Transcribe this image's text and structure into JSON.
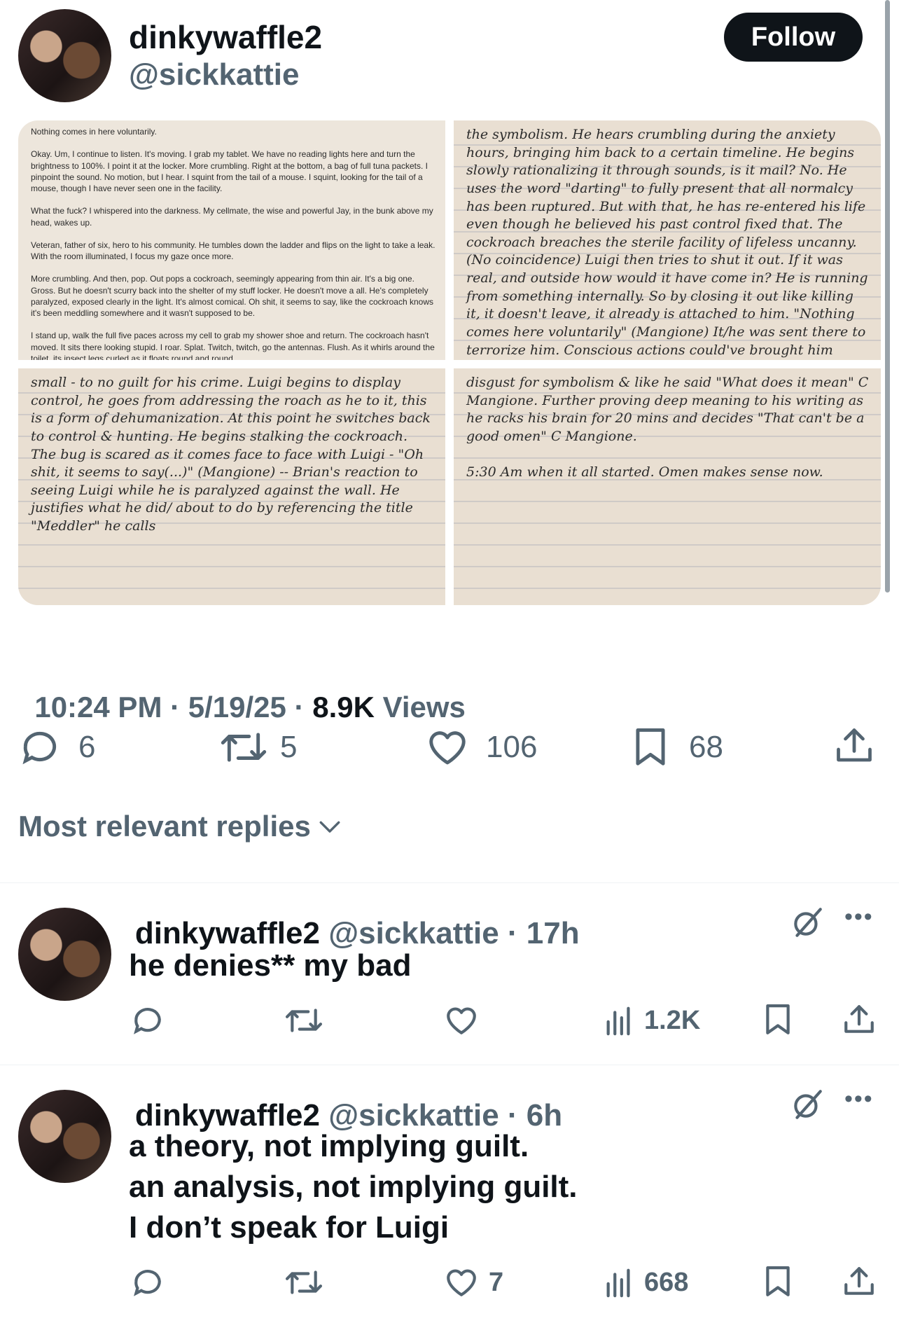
{
  "post": {
    "display_name": "dinkywaffle2",
    "handle": "@sickkattie",
    "follow_label": "Follow",
    "timestamp": "10:24 PM · 5/19/25 · ",
    "views_count": "8.9K",
    "views_label": " Views",
    "stats": {
      "replies": "6",
      "reposts": "5",
      "likes": "106",
      "bookmarks": "68"
    },
    "photos": [
      {
        "kind": "typed",
        "text": "Nothing comes in here voluntarily.\n\nOkay. Um, I continue to listen. It's moving. I grab my tablet. We have no reading lights here and turn the brightness to 100%. I point it at the locker. More crumbling. Right at the bottom, a bag of full tuna packets. I pinpoint the sound. No motion, but I hear. I squint from the tail of a mouse. I squint, looking for the tail of a mouse, though I have never seen one in the facility.\n\nWhat the fuck? I whispered into the darkness. My cellmate, the wise and powerful Jay, in the bunk above my head, wakes up.\n\nVeteran, father of six, hero to his community. He tumbles down the ladder and flips on the light to take a leak. With the room illuminated, I focus my gaze once more.\n\nMore crumbling. And then, pop. Out pops a cockroach, seemingly appearing from thin air. It's a big one. Gross. But he doesn't scurry back into the shelter of my stuff locker. He doesn't move a all. He's completely paralyzed, exposed clearly in the light. It's almost comical. Oh shit, it seems to say, like the cockroach knows it's been meddling somewhere and it wasn't supposed to be.\n\nI stand up, walk the full five paces across my cell to grab my shower shoe and return. The cockroach hasn't moved. It sits there looking stupid. I roar. Splat. Twitch, twitch, go the antennas. Flush. As it whirls around the toilet, its insect legs curled as it floats round and round"
      },
      {
        "kind": "hand",
        "text": "the symbolism. He hears crumbling during the anxiety hours, bringing him back to a certain timeline. He begins slowly rationalizing it through sounds, is it mail? No. He uses the word \"darting\" to fully present that all normalcy has been ruptured. But with that, he has re-entered his life even though he believed his past control fixed that. The cockroach breaches the sterile facility of lifeless uncanny. (No coincidence) Luigi then tries to shut it out. If it was real, and outside how would it have come in? He is running from something internally. So by closing it out like killing it, it doesn't leave, it already is attached to him. \"Nothing comes here voluntarily\" (Mangione) It/he was sent there to terrorize him. Conscious actions could've brought him back. He then becomes"
      },
      {
        "kind": "hand",
        "text": "small - to no guilt for his crime. Luigi begins to display control, he goes from addressing the roach as he to it, this is a form of dehumanization. At this point he switches back to control & hunting. He begins stalking the cockroach. The bug is scared as it comes face to face with Luigi - \"Oh shit, it seems to say(...)\" (Mangione) -- Brian's reaction to seeing Luigi while he is paralyzed against the wall. He justifies what he did/ about to do by referencing the title \"Meddler\" he calls"
      },
      {
        "kind": "hand",
        "text": "disgust for symbolism & like he said \"What does it mean\" C Mangione. Further proving deep meaning to his writing as he racks his brain for 20 mins and decides \"That can't be a good omen\" C Mangione.\n\n5:30 Am when it all started. Omen makes sense now."
      }
    ]
  },
  "replies_header": {
    "label": "Most relevant replies"
  },
  "replies": [
    {
      "display_name": "dinkywaffle2",
      "handle": "@sickkattie",
      "time": " · 17h",
      "lines": [
        "he denies** my bad"
      ],
      "reply_count": "",
      "repost_count": "",
      "like_count": "",
      "views": "1.2K"
    },
    {
      "display_name": "dinkywaffle2",
      "handle": "@sickkattie",
      "time": " · 6h",
      "lines": [
        "a theory, not implying guilt.",
        "an analysis, not implying guilt.",
        "I don’t speak for Luigi"
      ],
      "reply_count": "",
      "repost_count": "",
      "like_count": "7",
      "views": "668"
    }
  ]
}
